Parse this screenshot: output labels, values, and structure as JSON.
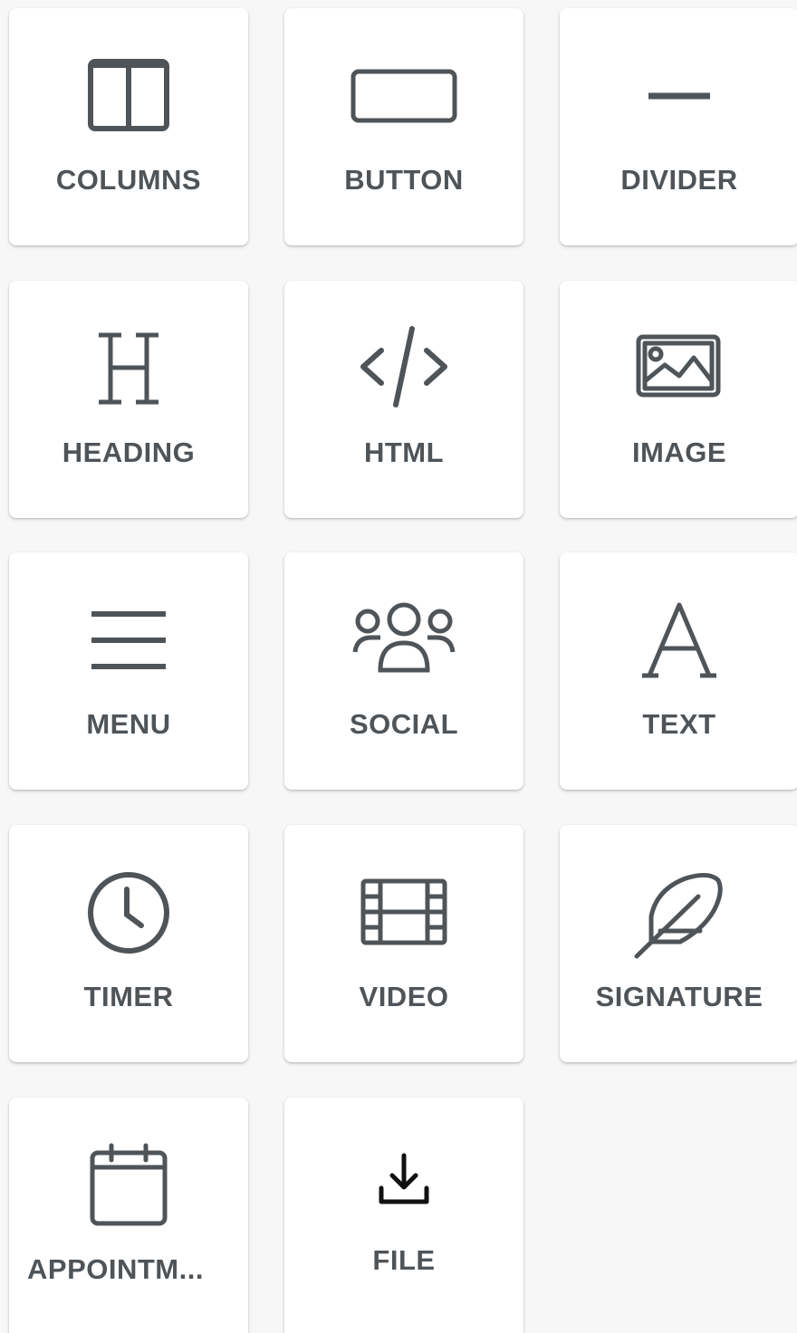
{
  "tiles": [
    {
      "label": "COLUMNS",
      "icon": "columns-icon"
    },
    {
      "label": "BUTTON",
      "icon": "button-icon"
    },
    {
      "label": "DIVIDER",
      "icon": "divider-icon"
    },
    {
      "label": "HEADING",
      "icon": "heading-icon"
    },
    {
      "label": "HTML",
      "icon": "html-code-icon"
    },
    {
      "label": "IMAGE",
      "icon": "image-icon"
    },
    {
      "label": "MENU",
      "icon": "menu-icon"
    },
    {
      "label": "SOCIAL",
      "icon": "social-people-icon"
    },
    {
      "label": "TEXT",
      "icon": "text-icon"
    },
    {
      "label": "TIMER",
      "icon": "clock-icon"
    },
    {
      "label": "VIDEO",
      "icon": "film-icon"
    },
    {
      "label": "SIGNATURE",
      "icon": "feather-icon"
    },
    {
      "label": "APPOINTM...",
      "icon": "calendar-icon"
    },
    {
      "label": "FILE",
      "icon": "download-icon"
    }
  ],
  "colors": {
    "icon": "#4f5458",
    "label": "#4f5458",
    "tile_background": "#ffffff",
    "page_background": "#f7f7f7"
  }
}
